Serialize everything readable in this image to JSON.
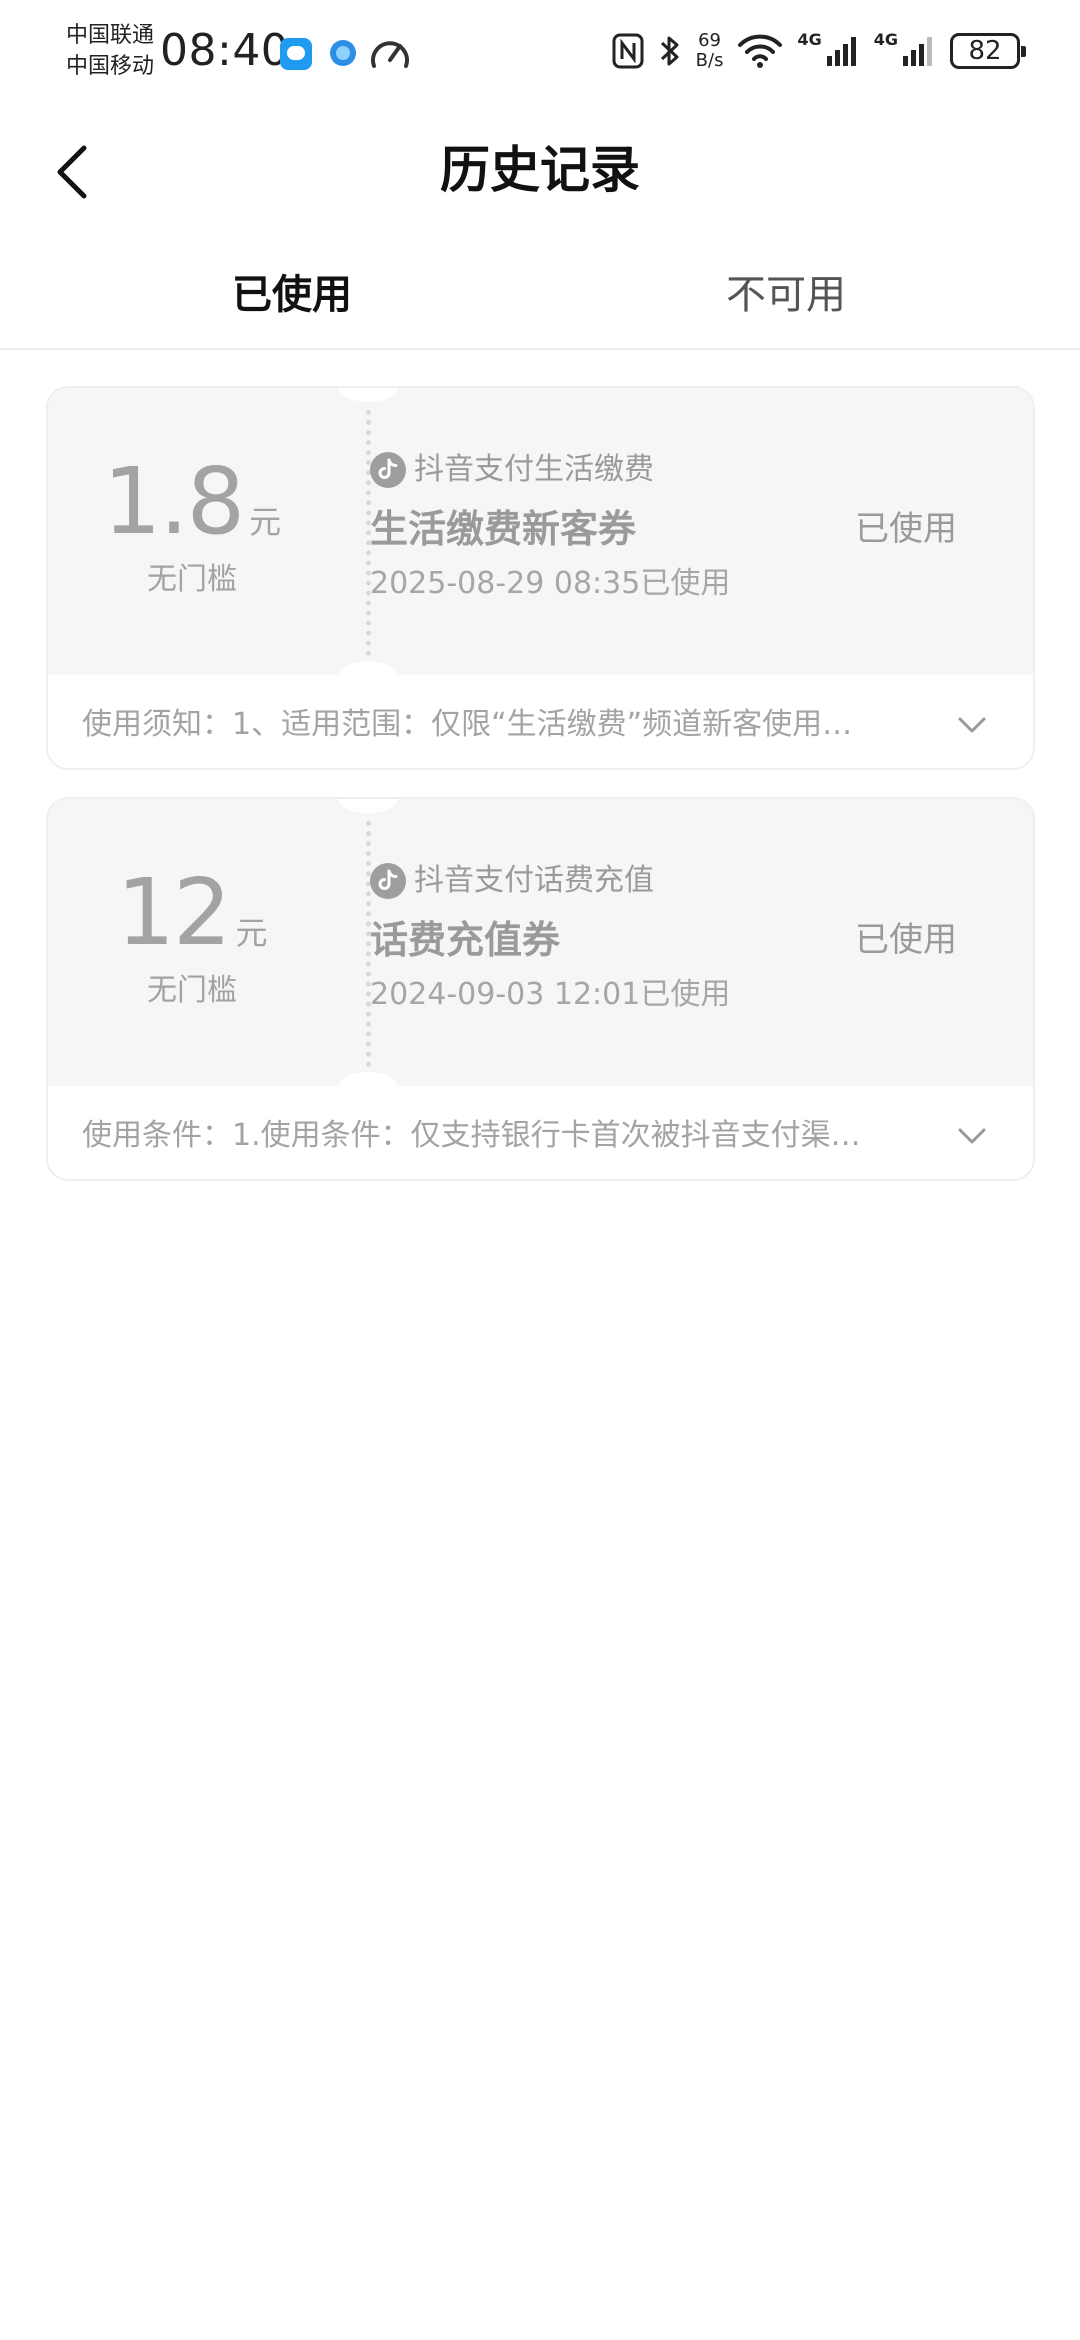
{
  "status_bar": {
    "carrier_1": "中国联通",
    "carrier_2": "中国移动",
    "time": "08:40",
    "net_speed_value": "69",
    "net_speed_unit": "B/s",
    "signal_1_label": "4G",
    "signal_2_label": "4G",
    "battery": "82",
    "icons": [
      "message-app-icon",
      "browser-app-icon",
      "speed-gauge-icon",
      "nfc-icon",
      "bluetooth-icon",
      "wifi-icon",
      "signal-icon",
      "battery-icon"
    ]
  },
  "header": {
    "title": "历史记录",
    "back_icon": "chevron-left-icon"
  },
  "tabs": [
    {
      "label": "已使用",
      "active": true
    },
    {
      "label": "不可用",
      "active": false
    }
  ],
  "coupons": [
    {
      "amount": "1.8",
      "unit": "元",
      "threshold": "无门槛",
      "brand": "抖音支付生活缴费",
      "name": "生活缴费新客券",
      "used_time": "2025-08-29 08:35已使用",
      "status": "已使用",
      "notice": "使用须知：1、适用范围：仅限“生活缴费”频道新客使用…"
    },
    {
      "amount": "12",
      "unit": "元",
      "threshold": "无门槛",
      "brand": "抖音支付话费充值",
      "name": "话费充值券",
      "used_time": "2024-09-03 12:01已使用",
      "status": "已使用",
      "notice": "使用条件：1.使用条件：仅支持银行卡首次被抖音支付渠…"
    }
  ],
  "colors": {
    "card_background": "#f6f6f6",
    "muted_text": "#a3a3a3",
    "title_text": "#111111"
  }
}
